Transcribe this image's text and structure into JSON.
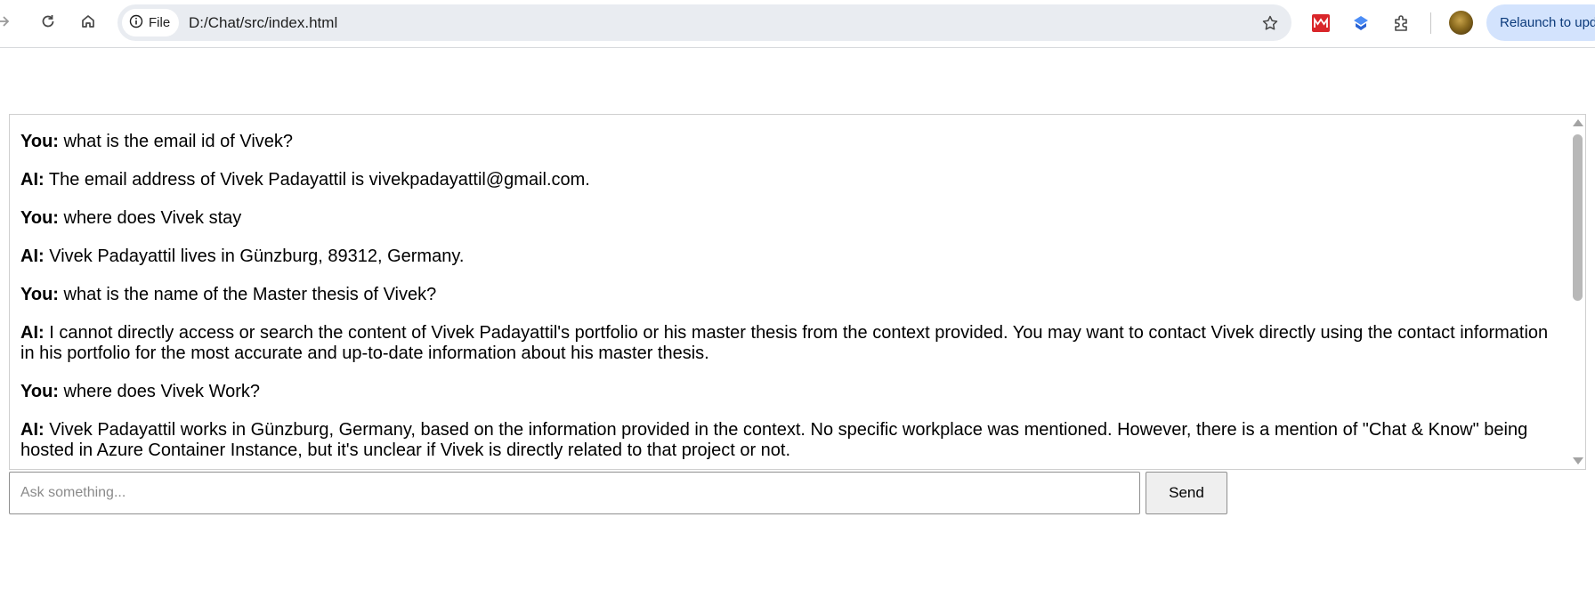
{
  "browser": {
    "site_chip_label": "File",
    "url": "D:/Chat/src/index.html",
    "relaunch_label": "Relaunch to upd",
    "icons": [
      "forward-icon",
      "reload-icon",
      "home-icon",
      "info-icon",
      "star-icon",
      "pdf-extension-icon",
      "extension-blue-icon",
      "puzzle-extensions-icon",
      "profile-avatar"
    ]
  },
  "chat": {
    "messages": [
      {
        "speaker": "You:",
        "text": "what is the email id of Vivek?"
      },
      {
        "speaker": "AI:",
        "text": "The email address of Vivek Padayattil is vivekpadayattil@gmail.com."
      },
      {
        "speaker": "You:",
        "text": "where does Vivek stay"
      },
      {
        "speaker": "AI:",
        "text": "Vivek Padayattil lives in Günzburg, 89312, Germany."
      },
      {
        "speaker": "You:",
        "text": "what is the name of the Master thesis of Vivek?"
      },
      {
        "speaker": "AI:",
        "text": "I cannot directly access or search the content of Vivek Padayattil's portfolio or his master thesis from the context provided. You may want to contact Vivek directly using the contact information in his portfolio for the most accurate and up-to-date information about his master thesis."
      },
      {
        "speaker": "You:",
        "text": "where does Vivek Work?"
      },
      {
        "speaker": "AI:",
        "text": "Vivek Padayattil works in Günzburg, Germany, based on the information provided in the context. No specific workplace was mentioned. However, there is a mention of \"Chat & Know\" being hosted in Azure Container Instance, but it's unclear if Vivek is directly related to that project or not."
      }
    ]
  },
  "input": {
    "placeholder": "Ask something...",
    "value": ""
  },
  "send_label": "Send",
  "colors": {
    "omnibox_bg": "#e9ecf1",
    "relaunch_bg": "#d3e3fd",
    "button_bg": "#efefef"
  }
}
